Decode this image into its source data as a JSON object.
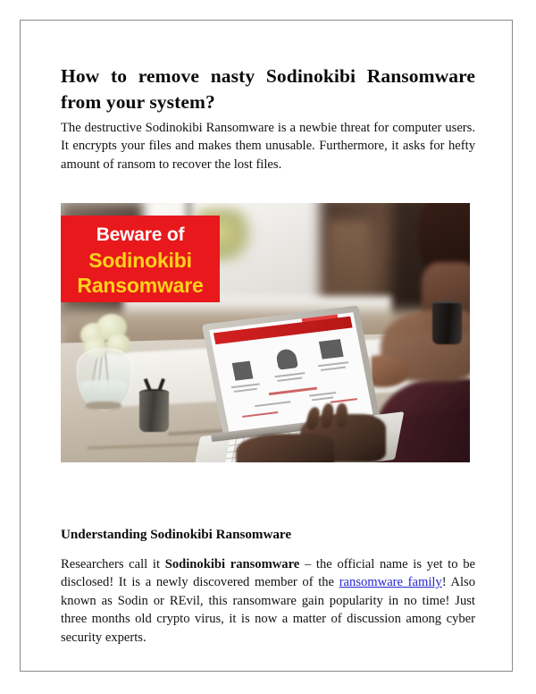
{
  "document": {
    "title": "How to remove nasty Sodinokibi Ransomware from your system?",
    "intro_paragraph": "The destructive Sodinokibi Ransomware is a newbie threat for computer users. It encrypts your files and makes them unusable. Furthermore, it asks for hefty amount of ransom to recover the lost files.",
    "section": {
      "heading": "Understanding Sodinokibi Ransomware",
      "paragraph_part_1": "Researchers call it ",
      "paragraph_bold_1": "Sodinokibi ransomware",
      "paragraph_part_2": " – the official name is yet to be disclosed! It is a newly discovered member of the ",
      "paragraph_link": "ransomware family",
      "paragraph_part_3": "! Also known as Sodin or REvil, this ransomware gain popularity in no time! Just three months old crypto virus, it is now a matter of discussion among cyber security experts."
    }
  },
  "illustration": {
    "banner": {
      "line_1": "Beware of",
      "line_2": "Sodinokibi",
      "line_3": "Ransomware",
      "background_color": "#e8181c",
      "line_1_color": "#ffffff",
      "line_2_color": "#ffd21a",
      "line_3_color": "#ffd21a"
    },
    "scene_description": "Photo of a person typing on a laptop at a wooden table with flowers in a glass vase, a pen cup, a potted succulent, a dark coffee mug and a bright window in the background"
  },
  "theme": {
    "page_background": "#ffffff",
    "page_border_color": "#8a8a8a",
    "text_color": "#121212",
    "link_color": "#2526cf"
  }
}
